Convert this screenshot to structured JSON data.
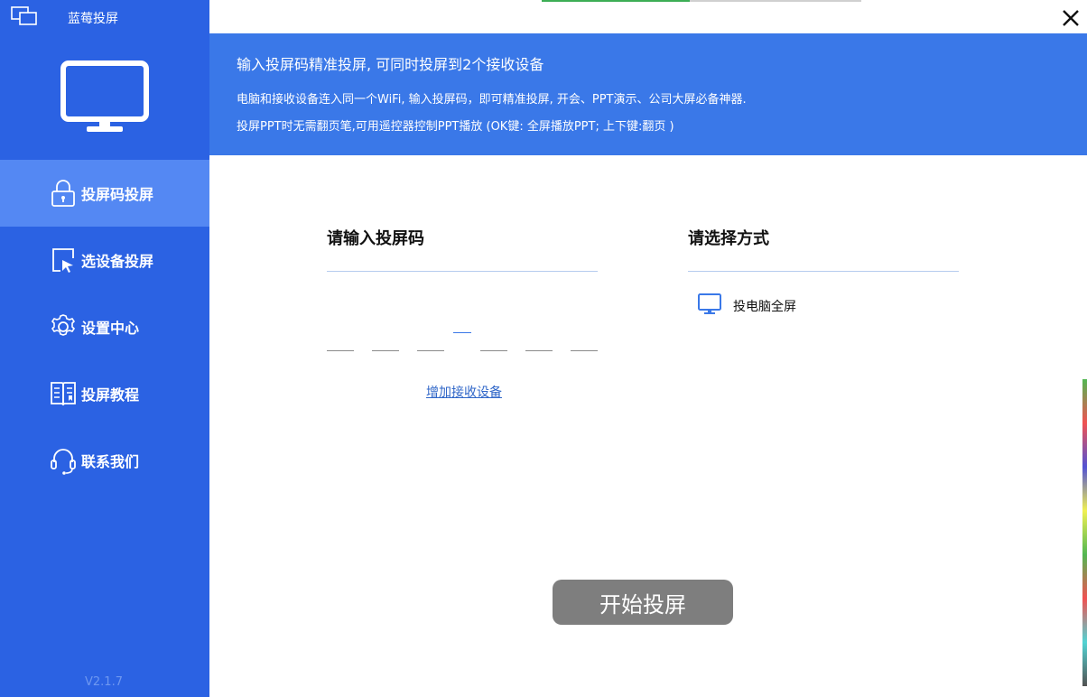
{
  "app": {
    "title": "蓝莓投屏",
    "version": "V2.1.7"
  },
  "sidebar": {
    "items": [
      {
        "label": "投屏码投屏",
        "icon": "lock-icon",
        "active": true
      },
      {
        "label": "选设备投屏",
        "icon": "cursor-screen-icon",
        "active": false
      },
      {
        "label": "设置中心",
        "icon": "gear-icon",
        "active": false
      },
      {
        "label": "投屏教程",
        "icon": "book-icon",
        "active": false
      },
      {
        "label": "联系我们",
        "icon": "headset-icon",
        "active": false
      }
    ]
  },
  "banner": {
    "title": "输入投屏码精准投屏, 可同时投屏到2个接收设备",
    "line1": "电脑和接收设备连入同一个WiFi, 输入投屏码，即可精准投屏, 开会、PPT演示、公司大屏必备神器.",
    "line2": "投屏PPT时无需翻页笔,可用遥控器控制PPT播放 (OK键: 全屏播放PPT; 上下键:翻页 )"
  },
  "code_panel": {
    "title": "请输入投屏码",
    "add_device_link": "增加接收设备"
  },
  "mode_panel": {
    "title": "请选择方式",
    "option_label": "投电脑全屏",
    "option_icon": "monitor-icon"
  },
  "start_button": "开始投屏",
  "colors": {
    "sidebar": "#2b62e3",
    "sidebar_active": "#5488f3",
    "banner": "#3a78e8",
    "start_button": "#7e7e7e"
  }
}
